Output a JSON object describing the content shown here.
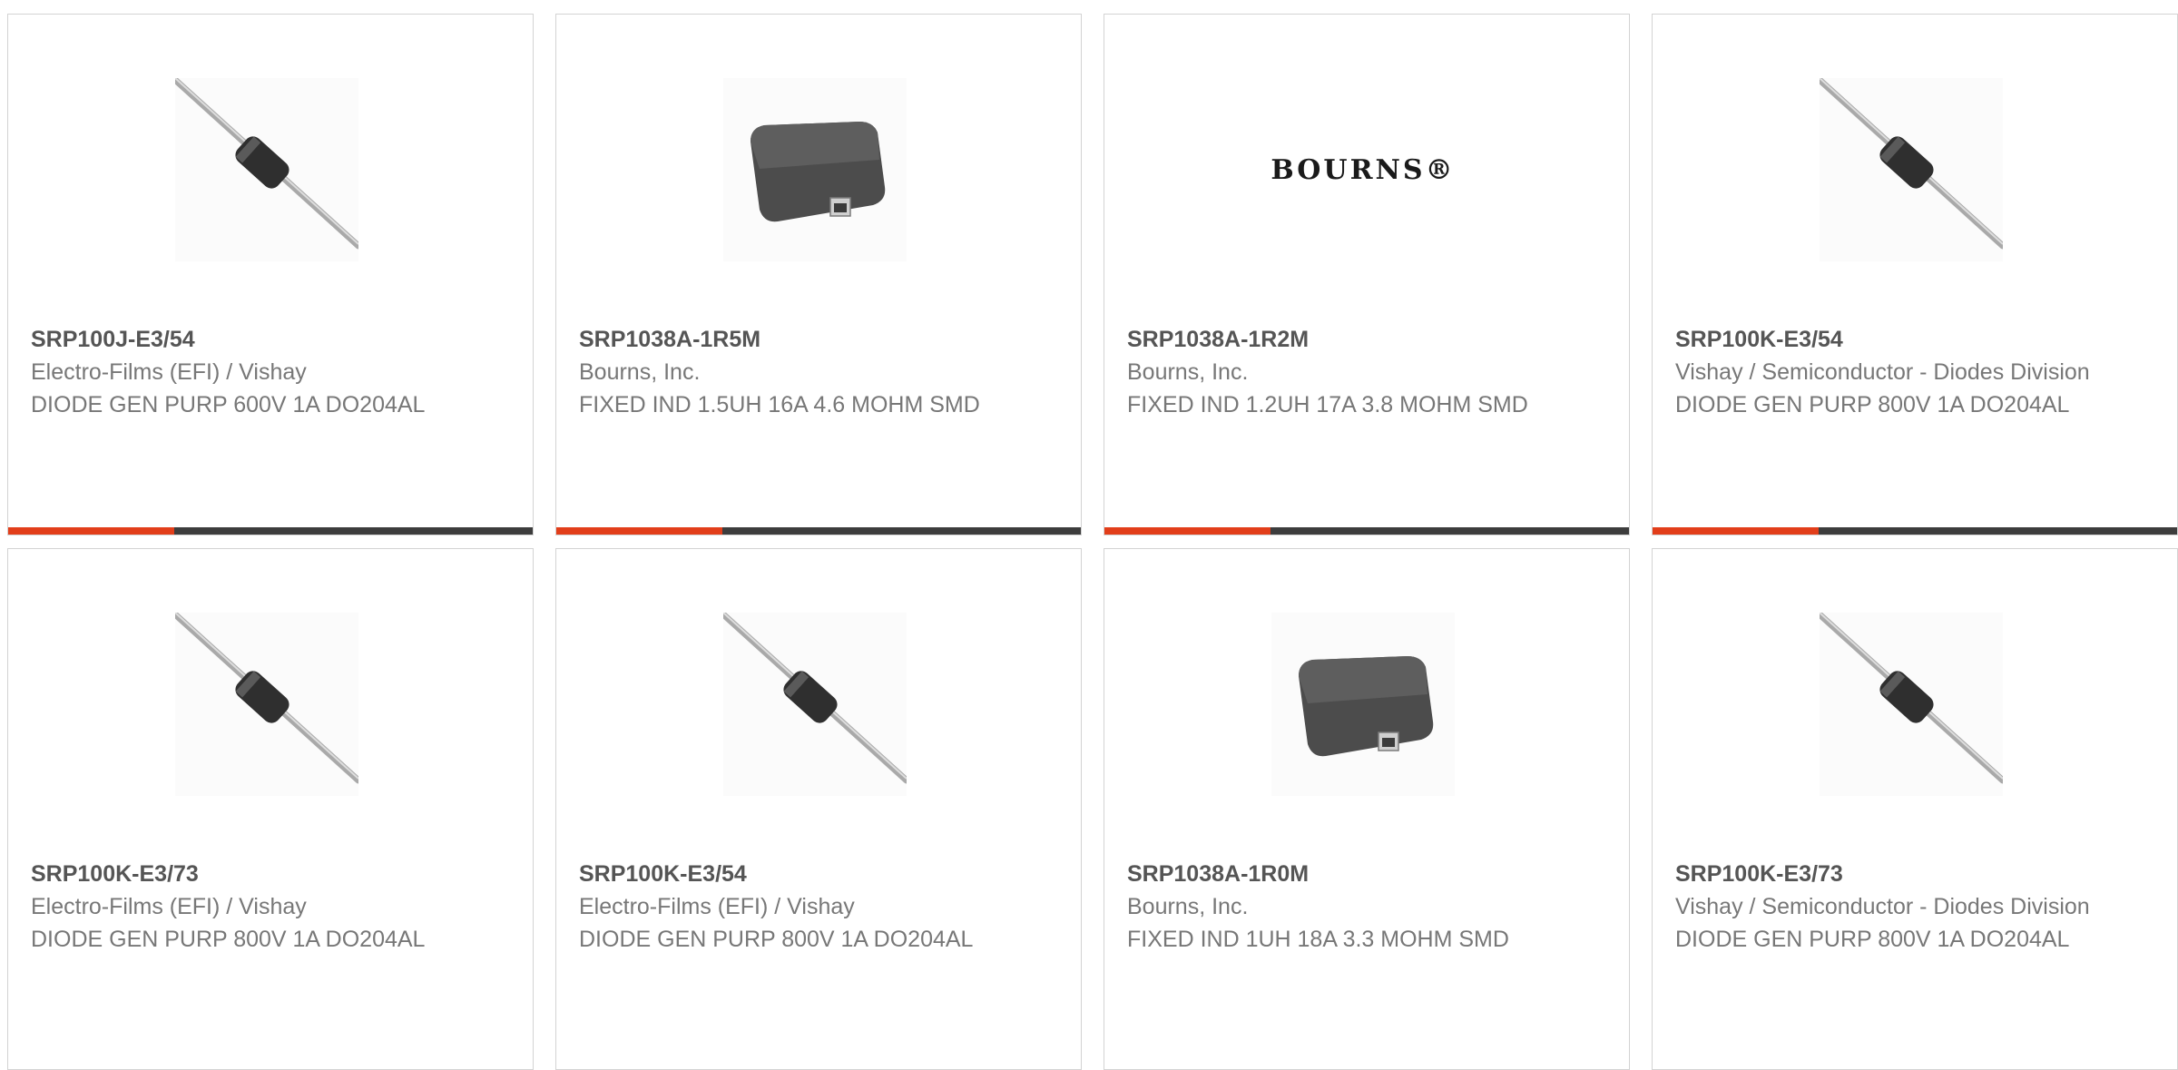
{
  "colors": {
    "accent": "#e23e1a",
    "bar": "#3d3d3d",
    "border": "#d3d3d3"
  },
  "products": [
    {
      "part_number": "SRP100J-E3/54",
      "manufacturer": "Electro-Films (EFI) / Vishay",
      "description": "DIODE GEN PURP 600V 1A DO204AL",
      "image": "axial-diode"
    },
    {
      "part_number": "SRP1038A-1R5M",
      "manufacturer": "Bourns, Inc.",
      "description": "FIXED IND 1.5UH 16A 4.6 MOHM SMD",
      "image": "smd-inductor"
    },
    {
      "part_number": "SRP1038A-1R2M",
      "manufacturer": "Bourns, Inc.",
      "description": "FIXED IND 1.2UH 17A 3.8 MOHM SMD",
      "image": "bourns-logo",
      "logo_text": "BOURNS®"
    },
    {
      "part_number": "SRP100K-E3/54",
      "manufacturer": "Vishay / Semiconductor - Diodes Division",
      "description": "DIODE GEN PURP 800V 1A DO204AL",
      "image": "axial-diode"
    },
    {
      "part_number": "SRP100K-E3/73",
      "manufacturer": "Electro-Films (EFI) / Vishay",
      "description": "DIODE GEN PURP 800V 1A DO204AL",
      "image": "axial-diode"
    },
    {
      "part_number": "SRP100K-E3/54",
      "manufacturer": "Electro-Films (EFI) / Vishay",
      "description": "DIODE GEN PURP 800V 1A DO204AL",
      "image": "axial-diode"
    },
    {
      "part_number": "SRP1038A-1R0M",
      "manufacturer": "Bourns, Inc.",
      "description": "FIXED IND 1UH 18A 3.3 MOHM SMD",
      "image": "smd-inductor"
    },
    {
      "part_number": "SRP100K-E3/73",
      "manufacturer": "Vishay / Semiconductor - Diodes Division",
      "description": "DIODE GEN PURP 800V 1A DO204AL",
      "image": "axial-diode"
    }
  ]
}
